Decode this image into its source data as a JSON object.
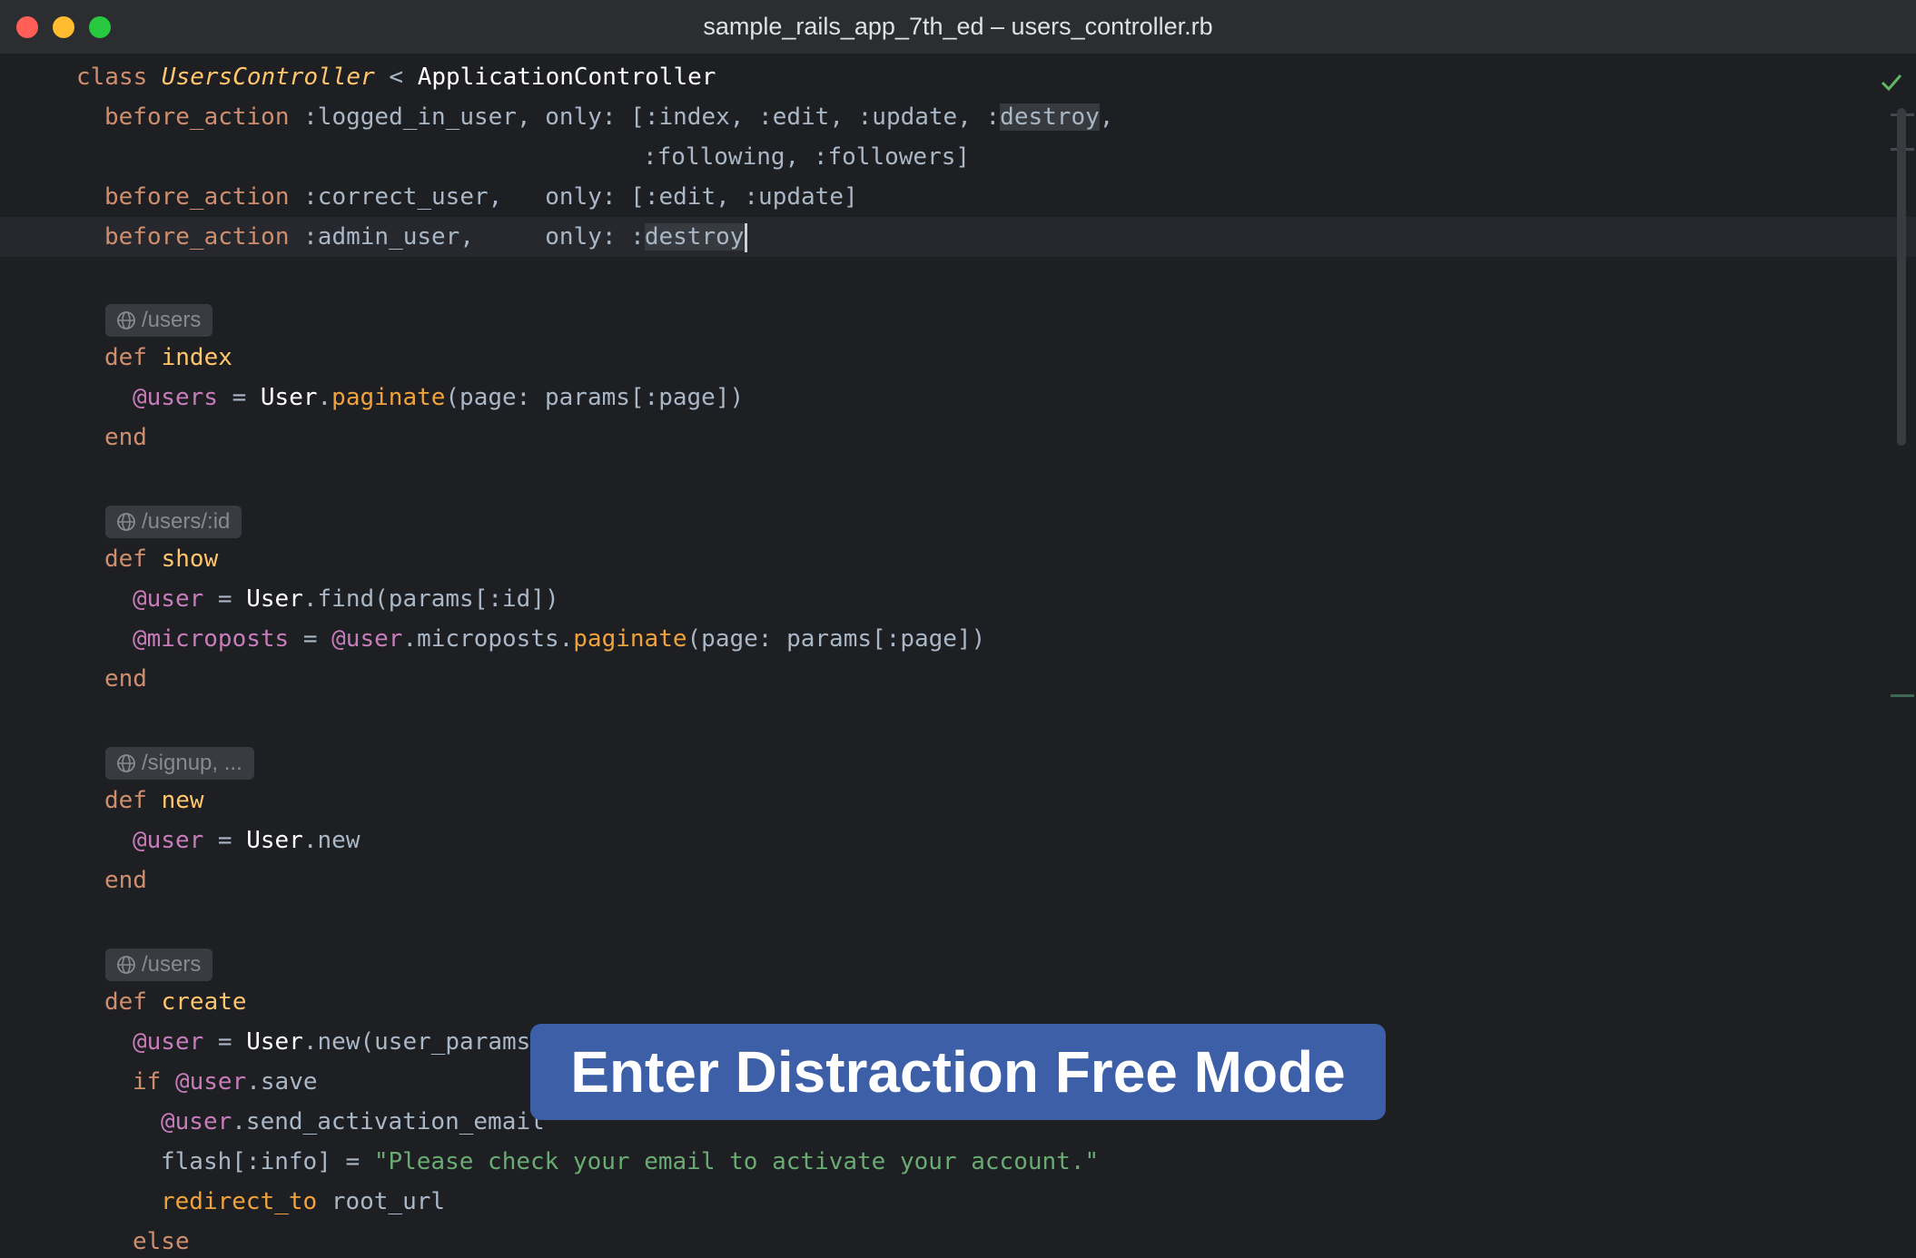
{
  "window": {
    "title": "sample_rails_app_7th_ed – users_controller.rb"
  },
  "route_hints": {
    "index": "/users",
    "show": "/users/:id",
    "new": "/signup, ...",
    "create": "/users"
  },
  "code": {
    "line_1": [
      "class ",
      "UsersController",
      " < ",
      "ApplicationController"
    ],
    "line_2": [
      "before_action",
      " :logged_in_user, only: [:index, :edit, :update, :",
      "destroy",
      ","
    ],
    "line_3": ":following, :followers]",
    "line_4": [
      "before_action",
      " :correct_user,   only: [:edit, :update]"
    ],
    "line_5": [
      "before_action",
      " :admin_user,     only: :",
      "destroy"
    ],
    "line_7": [
      "def ",
      "index"
    ],
    "line_8": [
      "@users",
      " = ",
      "User",
      ".",
      "paginate",
      "(page: params[:page])"
    ],
    "line_9": "end",
    "line_11": [
      "def ",
      "show"
    ],
    "line_12": [
      "@user",
      " = ",
      "User",
      ".find(params[:id])"
    ],
    "line_13": [
      "@microposts",
      " = ",
      "@user",
      ".microposts.",
      "paginate",
      "(page: params[:page])"
    ],
    "line_14": "end",
    "line_16": [
      "def ",
      "new"
    ],
    "line_17": [
      "@user",
      " = ",
      "User",
      ".new"
    ],
    "line_18": "end",
    "line_20": [
      "def ",
      "create"
    ],
    "line_21": [
      "@user",
      " = ",
      "User",
      ".new(user_params)"
    ],
    "line_22": [
      "if ",
      "@user",
      ".save"
    ],
    "line_23": [
      "@user",
      ".send_activation_email"
    ],
    "line_24": [
      "flash[:info] = ",
      "\"Please check your email to activate your account.\""
    ],
    "line_25": [
      "redirect_to",
      " root_url"
    ],
    "line_26": "else"
  },
  "overlay": {
    "action_tooltip": "Enter Distraction Free Mode"
  },
  "colors": {
    "background": "#1e1f22",
    "keyword": "#cf8e6d",
    "method": "#ffc66d",
    "instance_variable": "#c77dbb",
    "string": "#6aab73",
    "tooltip": "#3d5fa8"
  },
  "icons": {
    "route": "globe-icon",
    "inspection_status": "checkmark-icon"
  }
}
